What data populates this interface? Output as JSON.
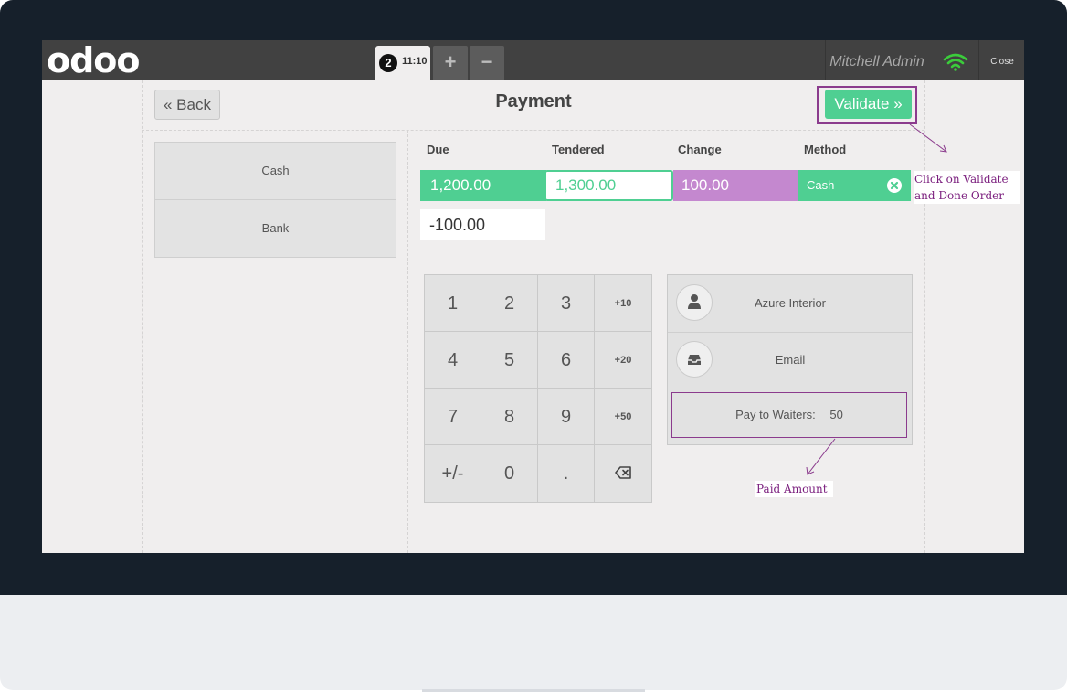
{
  "topbar": {
    "logo": "odoo",
    "order_number": "2",
    "order_time": "11:10",
    "add_order": "+",
    "remove_order": "−",
    "user": "Mitchell Admin",
    "close": "Close"
  },
  "payment": {
    "back_label": "« Back",
    "title": "Payment",
    "validate_label": "Validate »",
    "methods": [
      "Cash",
      "Bank"
    ],
    "headers": {
      "due": "Due",
      "tendered": "Tendered",
      "change": "Change",
      "method": "Method"
    },
    "line": {
      "due": "1,200.00",
      "tendered": "1,300.00",
      "change": "100.00",
      "method": "Cash"
    },
    "remaining": "-100.00"
  },
  "numpad": {
    "keys": [
      "1",
      "2",
      "3",
      "+10",
      "4",
      "5",
      "6",
      "+20",
      "7",
      "8",
      "9",
      "+50",
      "+/-",
      "0",
      ".",
      ""
    ]
  },
  "side_buttons": {
    "customer": "Azure Interior",
    "email": "Email",
    "pay_to_waiters_label": "Pay to Waiters:",
    "pay_to_waiters_value": "50"
  },
  "annotations": {
    "validate_note_line1": "Click on Validate",
    "validate_note_line2": "and Done Order",
    "paid_amount_note": "Paid Amount"
  },
  "colors": {
    "green": "#4fcf92",
    "purple": "#c488cf",
    "annotation": "#8b3b8d",
    "topbar": "#414141"
  }
}
